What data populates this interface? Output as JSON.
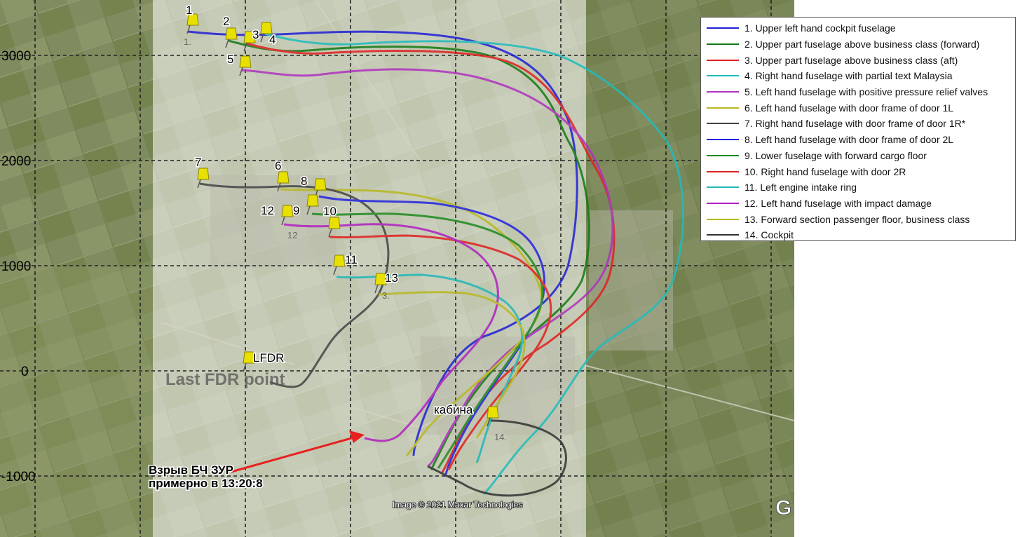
{
  "y_axis_labels": [
    "3000",
    "2000",
    "1000",
    "0",
    "-1000"
  ],
  "legend": [
    {
      "label": "1. Upper left hand cockpit fuselage",
      "color": "#1f1fd6"
    },
    {
      "label": "2. Upper part fuselage above business class (forward)",
      "color": "#137a13"
    },
    {
      "label": "3. Upper part fuselage above business class (aft)",
      "color": "#e02020"
    },
    {
      "label": "4. Right hand fuselage with partial text Malaysia",
      "color": "#1fbcbc"
    },
    {
      "label": "5. Left hand fuselage with positive pressure relief valves",
      "color": "#b030c0"
    },
    {
      "label": "6. Left hand fuselage with door frame of door 1L",
      "color": "#b8b820"
    },
    {
      "label": "7. Right hand fuselage with door frame of door 1R*",
      "color": "#444444"
    },
    {
      "label": "8. Left hand fuselage with door frame of door 2L",
      "color": "#2222e0"
    },
    {
      "label": "9. Lower fuselage with forward cargo floor",
      "color": "#1e8a1e"
    },
    {
      "label": "10. Right hand fuselage with door 2R",
      "color": "#e02020"
    },
    {
      "label": "11. Left engine intake ring",
      "color": "#20b8b8"
    },
    {
      "label": "12. Left hand fuselage with impact damage",
      "color": "#b020c0"
    },
    {
      "label": "13. Forward section passenger floor, business class",
      "color": "#b8b820"
    },
    {
      "label": "14. Cockpit",
      "color": "#333333"
    }
  ],
  "pins": [
    {
      "label": "1"
    },
    {
      "label": "2"
    },
    {
      "label": "3"
    },
    {
      "label": "4"
    },
    {
      "label": "5"
    },
    {
      "label": "6"
    },
    {
      "label": "7"
    },
    {
      "label": "8"
    },
    {
      "label": "9"
    },
    {
      "label": "10"
    },
    {
      "label": "11"
    },
    {
      "label": "12"
    },
    {
      "label": "13"
    },
    {
      "label": "LFDR"
    },
    {
      "label": "кабина"
    }
  ],
  "ground_labels": [
    "1.",
    "12",
    "3.",
    "14."
  ],
  "last_fdr_text": "Last FDR point",
  "explosion_line1": "Взрыв БЧ ЗУР",
  "explosion_line2": "примерно в 13:20:8",
  "image_credit": "Image © 2021 Maxar Technologies",
  "google_mark": "G"
}
